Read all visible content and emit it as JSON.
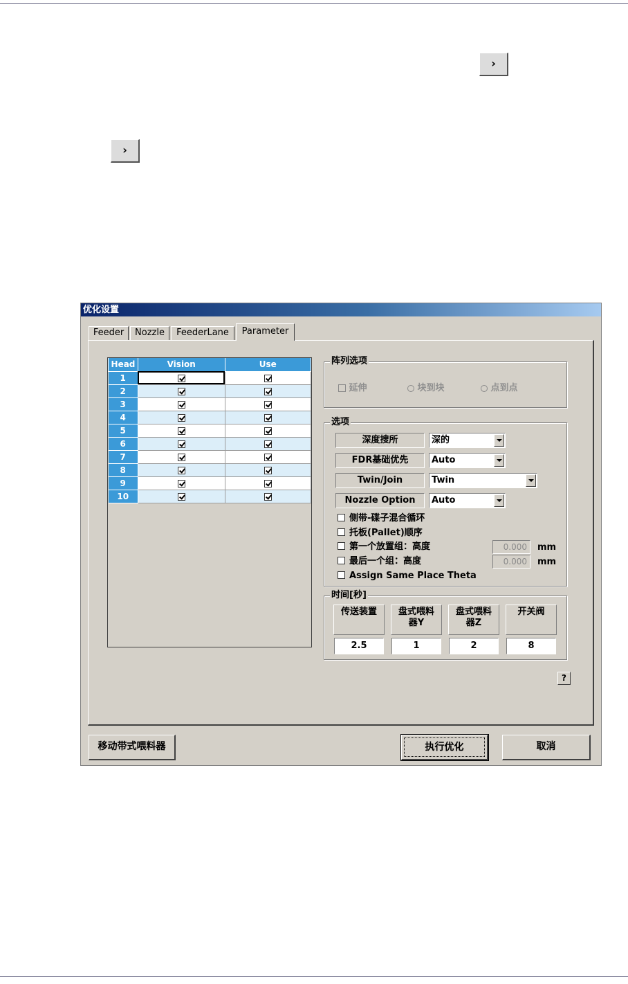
{
  "page_buttons": {
    "top_arrow": "›",
    "left_arrow": "›"
  },
  "dialog": {
    "title": "优化设置",
    "tabs": [
      "Feeder",
      "Nozzle",
      "FeederLane",
      "Parameter"
    ],
    "active_tab": "Parameter",
    "head_table": {
      "columns": [
        "Head",
        "Vision",
        "Use"
      ],
      "rows": [
        {
          "head": "1",
          "vision": true,
          "use": true
        },
        {
          "head": "2",
          "vision": true,
          "use": true
        },
        {
          "head": "3",
          "vision": true,
          "use": true
        },
        {
          "head": "4",
          "vision": true,
          "use": true
        },
        {
          "head": "5",
          "vision": true,
          "use": true
        },
        {
          "head": "6",
          "vision": true,
          "use": true
        },
        {
          "head": "7",
          "vision": true,
          "use": true
        },
        {
          "head": "8",
          "vision": true,
          "use": true
        },
        {
          "head": "9",
          "vision": true,
          "use": true
        },
        {
          "head": "10",
          "vision": true,
          "use": true
        }
      ]
    },
    "array_options": {
      "legend": "阵列选项",
      "extend_label": "延伸",
      "block_to_block_label": "块到块",
      "point_to_point_label": "点到点"
    },
    "options": {
      "legend": "选项",
      "depth_search": {
        "label": "深度搜所",
        "value": "深的"
      },
      "fdr_priority": {
        "label": "FDR基础优先",
        "value": "Auto"
      },
      "twin_join": {
        "label": "Twin/Join",
        "value": "Twin"
      },
      "nozzle_option": {
        "label": "Nozzle Option",
        "value": "Auto"
      },
      "side_tray_loop_label": "侧带-碟子混合循环",
      "pallet_order_label": "托板(Pallet)顺序",
      "first_group_label": "第一个放置组：高度",
      "first_group_value": "0.000",
      "last_group_label": "最后一个组：高度",
      "last_group_value": "0.000",
      "unit": "mm",
      "assign_theta_label": "Assign Same Place Theta"
    },
    "time": {
      "legend": "时间[秒]",
      "columns": [
        {
          "header_line1": "传送装置",
          "header_line2": "",
          "value": "2.5"
        },
        {
          "header_line1": "盘式喂料",
          "header_line2": "器Y",
          "value": "1"
        },
        {
          "header_line1": "盘式喂料",
          "header_line2": "器Z",
          "value": "2"
        },
        {
          "header_line1": "开关阀",
          "header_line2": "",
          "value": "8"
        }
      ]
    },
    "help_label": "?",
    "buttons": {
      "move_feeder": "移动带式喂料器",
      "run_optimize": "执行优化",
      "cancel": "取消"
    }
  }
}
